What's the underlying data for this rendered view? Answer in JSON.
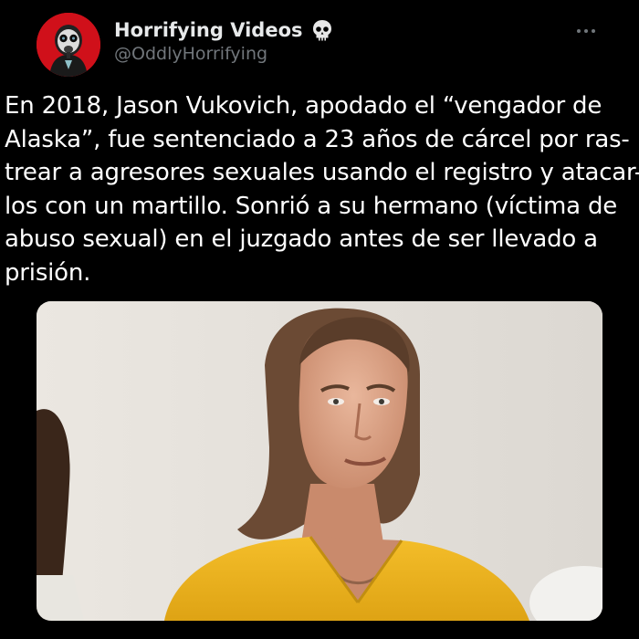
{
  "author": {
    "display_name": "Horrifying Videos",
    "handle": "@OddlyHorrifying",
    "avatar_icon": "gas-mask-avatar-icon",
    "badge_icon": "skull-icon"
  },
  "tweet": {
    "lines": [
      "En 2018, Jason Vukovich, apodado el “vengador de",
      "Alaska”, fue sentenciado a 23 años de cárcel por ras-",
      "trear a agresores sexuales usando el registro y atacar-",
      "los con un martillo. Sonrió a su hermano (víctima de",
      "abuso sexual) en el juzgado antes de ser llevado a",
      "prisión."
    ]
  },
  "media": {
    "description_icon": "photo-man-yellow-jumpsuit"
  },
  "colors": {
    "background": "#000000",
    "avatar_bg": "#d0101a",
    "text_primary": "#ffffff",
    "text_secondary": "#71767b",
    "jumpsuit": "#f0b51c"
  }
}
